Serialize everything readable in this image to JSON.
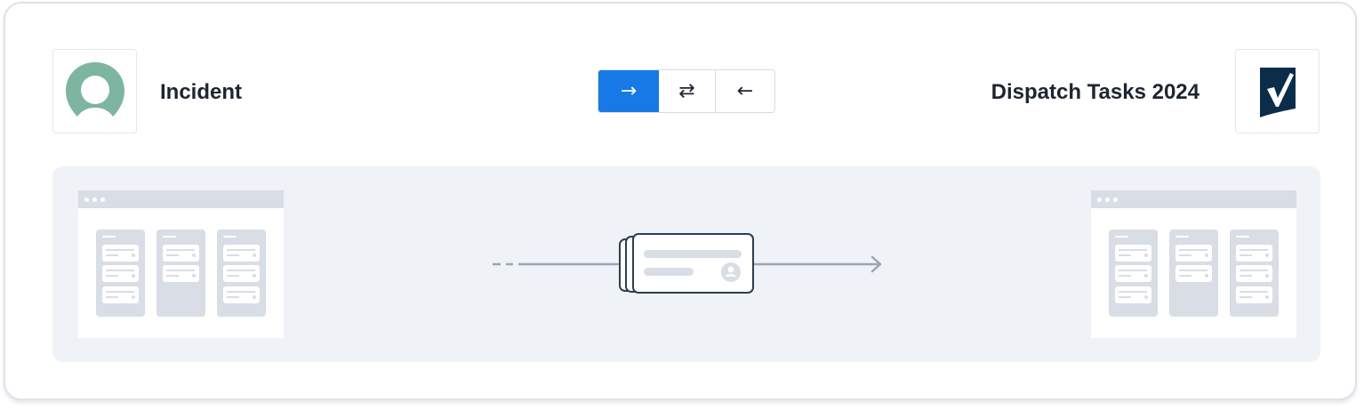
{
  "source_app": {
    "name": "Incident",
    "logo_icon": "incident-logo-icon",
    "color": "#7db5a0"
  },
  "target_app": {
    "name": "Dispatch Tasks 2024",
    "logo_icon": "smartsheet-logo-icon",
    "color": "#0c2d4a"
  },
  "direction": {
    "options": [
      {
        "glyph": "→",
        "label": "one-way source to target",
        "active": true
      },
      {
        "glyph": "⇄",
        "label": "two-way sync",
        "active": false
      },
      {
        "glyph": "←",
        "label": "one-way target to source",
        "active": false
      }
    ],
    "accent": "#1779e6"
  }
}
